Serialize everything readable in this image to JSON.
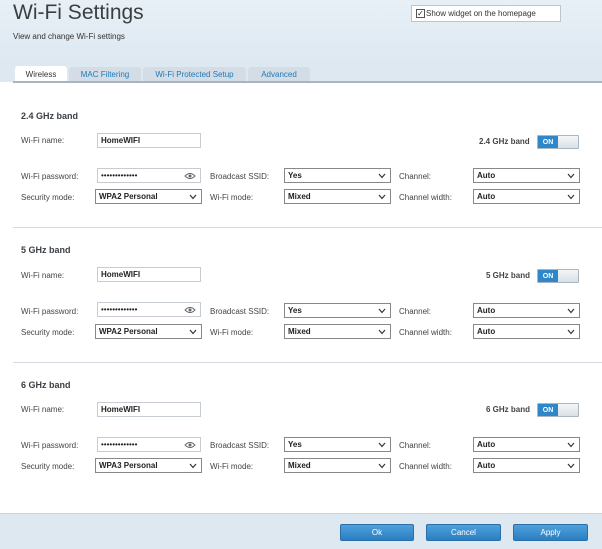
{
  "header": {
    "title": "Wi-Fi Settings",
    "subtitle": "View and change Wi-Fi settings",
    "widget_label": "Show widget on the homepage",
    "widget_checked": "✓"
  },
  "tabs": [
    {
      "label": "Wireless"
    },
    {
      "label": "MAC Filtering"
    },
    {
      "label": "Wi-Fi Protected Setup"
    },
    {
      "label": "Advanced"
    }
  ],
  "labels": {
    "wifi_name": "Wi-Fi name:",
    "wifi_password": "Wi-Fi password:",
    "security_mode": "Security mode:",
    "broadcast_ssid": "Broadcast SSID:",
    "wifi_mode": "Wi-Fi mode:",
    "channel": "Channel:",
    "channel_width": "Channel width:"
  },
  "bands": [
    {
      "title": "2.4 GHz band",
      "toggle_label": "2.4 GHz band",
      "toggle_state": "ON",
      "wifi_name": "HomeWIFI",
      "password_mask": "•••••••••••••",
      "broadcast_ssid": "Yes",
      "channel": "Auto",
      "security_mode": "WPA2 Personal",
      "wifi_mode": "Mixed",
      "channel_width": "Auto"
    },
    {
      "title": "5 GHz band",
      "toggle_label": "5 GHz band",
      "toggle_state": "ON",
      "wifi_name": "HomeWIFI",
      "password_mask": "•••••••••••••",
      "broadcast_ssid": "Yes",
      "channel": "Auto",
      "security_mode": "WPA2 Personal",
      "wifi_mode": "Mixed",
      "channel_width": "Auto"
    },
    {
      "title": "6 GHz band",
      "toggle_label": "6 GHz band",
      "toggle_state": "ON",
      "wifi_name": "HomeWIFI",
      "password_mask": "•••••••••••••",
      "broadcast_ssid": "Yes",
      "channel": "Auto",
      "security_mode": "WPA3 Personal",
      "wifi_mode": "Mixed",
      "channel_width": "Auto"
    }
  ],
  "footer": {
    "ok_label": "Ok",
    "cancel_label": "Cancel",
    "apply_label": "Apply"
  },
  "icons": {
    "eye": "eye-icon",
    "chevron": "chevron-down-icon",
    "check": "check-icon"
  },
  "colors": {
    "accent": "#2d87c8",
    "header_bg": "#dde8f1"
  }
}
